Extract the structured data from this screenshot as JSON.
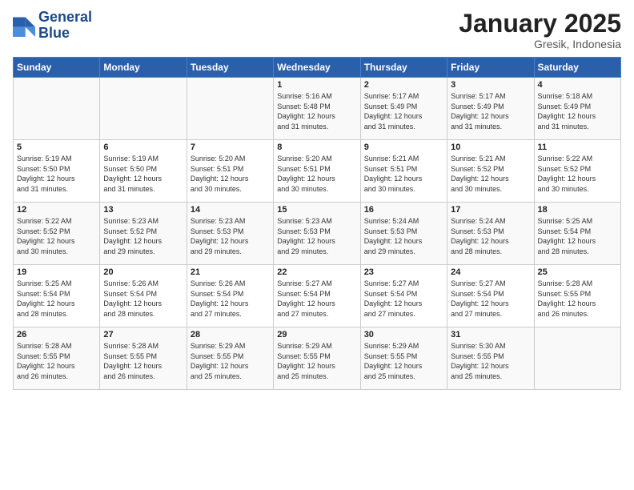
{
  "logo": {
    "line1": "General",
    "line2": "Blue"
  },
  "title": "January 2025",
  "subtitle": "Gresik, Indonesia",
  "weekdays": [
    "Sunday",
    "Monday",
    "Tuesday",
    "Wednesday",
    "Thursday",
    "Friday",
    "Saturday"
  ],
  "weeks": [
    [
      {
        "day": "",
        "info": ""
      },
      {
        "day": "",
        "info": ""
      },
      {
        "day": "",
        "info": ""
      },
      {
        "day": "1",
        "info": "Sunrise: 5:16 AM\nSunset: 5:48 PM\nDaylight: 12 hours\nand 31 minutes."
      },
      {
        "day": "2",
        "info": "Sunrise: 5:17 AM\nSunset: 5:49 PM\nDaylight: 12 hours\nand 31 minutes."
      },
      {
        "day": "3",
        "info": "Sunrise: 5:17 AM\nSunset: 5:49 PM\nDaylight: 12 hours\nand 31 minutes."
      },
      {
        "day": "4",
        "info": "Sunrise: 5:18 AM\nSunset: 5:49 PM\nDaylight: 12 hours\nand 31 minutes."
      }
    ],
    [
      {
        "day": "5",
        "info": "Sunrise: 5:19 AM\nSunset: 5:50 PM\nDaylight: 12 hours\nand 31 minutes."
      },
      {
        "day": "6",
        "info": "Sunrise: 5:19 AM\nSunset: 5:50 PM\nDaylight: 12 hours\nand 31 minutes."
      },
      {
        "day": "7",
        "info": "Sunrise: 5:20 AM\nSunset: 5:51 PM\nDaylight: 12 hours\nand 30 minutes."
      },
      {
        "day": "8",
        "info": "Sunrise: 5:20 AM\nSunset: 5:51 PM\nDaylight: 12 hours\nand 30 minutes."
      },
      {
        "day": "9",
        "info": "Sunrise: 5:21 AM\nSunset: 5:51 PM\nDaylight: 12 hours\nand 30 minutes."
      },
      {
        "day": "10",
        "info": "Sunrise: 5:21 AM\nSunset: 5:52 PM\nDaylight: 12 hours\nand 30 minutes."
      },
      {
        "day": "11",
        "info": "Sunrise: 5:22 AM\nSunset: 5:52 PM\nDaylight: 12 hours\nand 30 minutes."
      }
    ],
    [
      {
        "day": "12",
        "info": "Sunrise: 5:22 AM\nSunset: 5:52 PM\nDaylight: 12 hours\nand 30 minutes."
      },
      {
        "day": "13",
        "info": "Sunrise: 5:23 AM\nSunset: 5:52 PM\nDaylight: 12 hours\nand 29 minutes."
      },
      {
        "day": "14",
        "info": "Sunrise: 5:23 AM\nSunset: 5:53 PM\nDaylight: 12 hours\nand 29 minutes."
      },
      {
        "day": "15",
        "info": "Sunrise: 5:23 AM\nSunset: 5:53 PM\nDaylight: 12 hours\nand 29 minutes."
      },
      {
        "day": "16",
        "info": "Sunrise: 5:24 AM\nSunset: 5:53 PM\nDaylight: 12 hours\nand 29 minutes."
      },
      {
        "day": "17",
        "info": "Sunrise: 5:24 AM\nSunset: 5:53 PM\nDaylight: 12 hours\nand 28 minutes."
      },
      {
        "day": "18",
        "info": "Sunrise: 5:25 AM\nSunset: 5:54 PM\nDaylight: 12 hours\nand 28 minutes."
      }
    ],
    [
      {
        "day": "19",
        "info": "Sunrise: 5:25 AM\nSunset: 5:54 PM\nDaylight: 12 hours\nand 28 minutes."
      },
      {
        "day": "20",
        "info": "Sunrise: 5:26 AM\nSunset: 5:54 PM\nDaylight: 12 hours\nand 28 minutes."
      },
      {
        "day": "21",
        "info": "Sunrise: 5:26 AM\nSunset: 5:54 PM\nDaylight: 12 hours\nand 27 minutes."
      },
      {
        "day": "22",
        "info": "Sunrise: 5:27 AM\nSunset: 5:54 PM\nDaylight: 12 hours\nand 27 minutes."
      },
      {
        "day": "23",
        "info": "Sunrise: 5:27 AM\nSunset: 5:54 PM\nDaylight: 12 hours\nand 27 minutes."
      },
      {
        "day": "24",
        "info": "Sunrise: 5:27 AM\nSunset: 5:54 PM\nDaylight: 12 hours\nand 27 minutes."
      },
      {
        "day": "25",
        "info": "Sunrise: 5:28 AM\nSunset: 5:55 PM\nDaylight: 12 hours\nand 26 minutes."
      }
    ],
    [
      {
        "day": "26",
        "info": "Sunrise: 5:28 AM\nSunset: 5:55 PM\nDaylight: 12 hours\nand 26 minutes."
      },
      {
        "day": "27",
        "info": "Sunrise: 5:28 AM\nSunset: 5:55 PM\nDaylight: 12 hours\nand 26 minutes."
      },
      {
        "day": "28",
        "info": "Sunrise: 5:29 AM\nSunset: 5:55 PM\nDaylight: 12 hours\nand 25 minutes."
      },
      {
        "day": "29",
        "info": "Sunrise: 5:29 AM\nSunset: 5:55 PM\nDaylight: 12 hours\nand 25 minutes."
      },
      {
        "day": "30",
        "info": "Sunrise: 5:29 AM\nSunset: 5:55 PM\nDaylight: 12 hours\nand 25 minutes."
      },
      {
        "day": "31",
        "info": "Sunrise: 5:30 AM\nSunset: 5:55 PM\nDaylight: 12 hours\nand 25 minutes."
      },
      {
        "day": "",
        "info": ""
      }
    ]
  ]
}
